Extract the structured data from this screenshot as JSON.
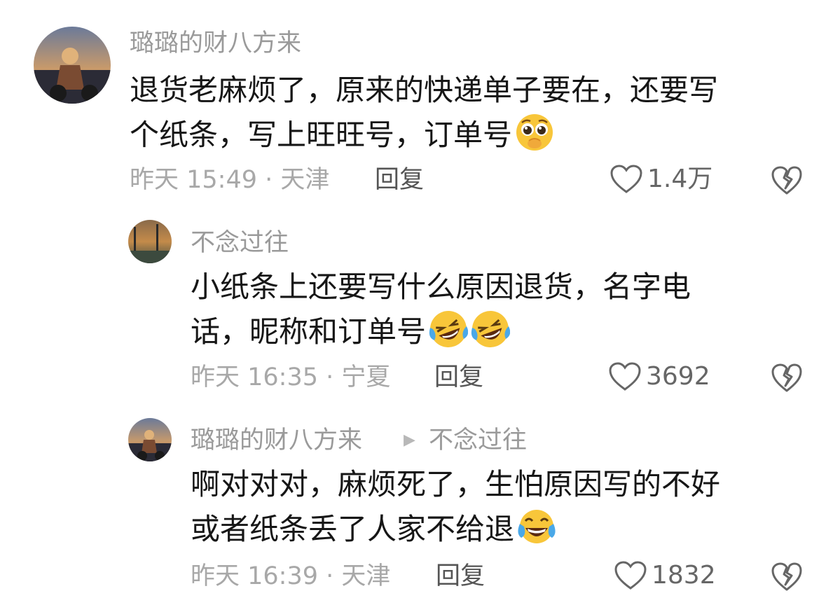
{
  "comments": [
    {
      "username": "璐璐的财八方来",
      "text_line1": "退货老麻烦了，原来的快递单子要在，还要写",
      "text_line2": "个纸条，写上旺旺号，订单号",
      "emoji": [
        "pleading-emoji"
      ],
      "meta": "昨天 15:49 · 天津",
      "reply_label": "回复",
      "likes": "1.4万"
    },
    {
      "username": "不念过往",
      "text_line1": "小纸条上还要写什么原因退货，名字电",
      "text_line2": "话，昵称和订单号",
      "emoji": [
        "rofl-emoji",
        "rofl-emoji"
      ],
      "meta": "昨天 16:35 · 宁夏",
      "reply_label": "回复",
      "likes": "3692"
    },
    {
      "username": "璐璐的财八方来",
      "reply_to": "不念过往",
      "text_line1": "啊对对对，麻烦死了，生怕原因写的不好",
      "text_line2": "或者纸条丢了人家不给退",
      "emoji": [
        "tears-of-joy-emoji"
      ],
      "meta": "昨天 16:39 · 天津",
      "reply_label": "回复",
      "likes": "1832"
    }
  ]
}
